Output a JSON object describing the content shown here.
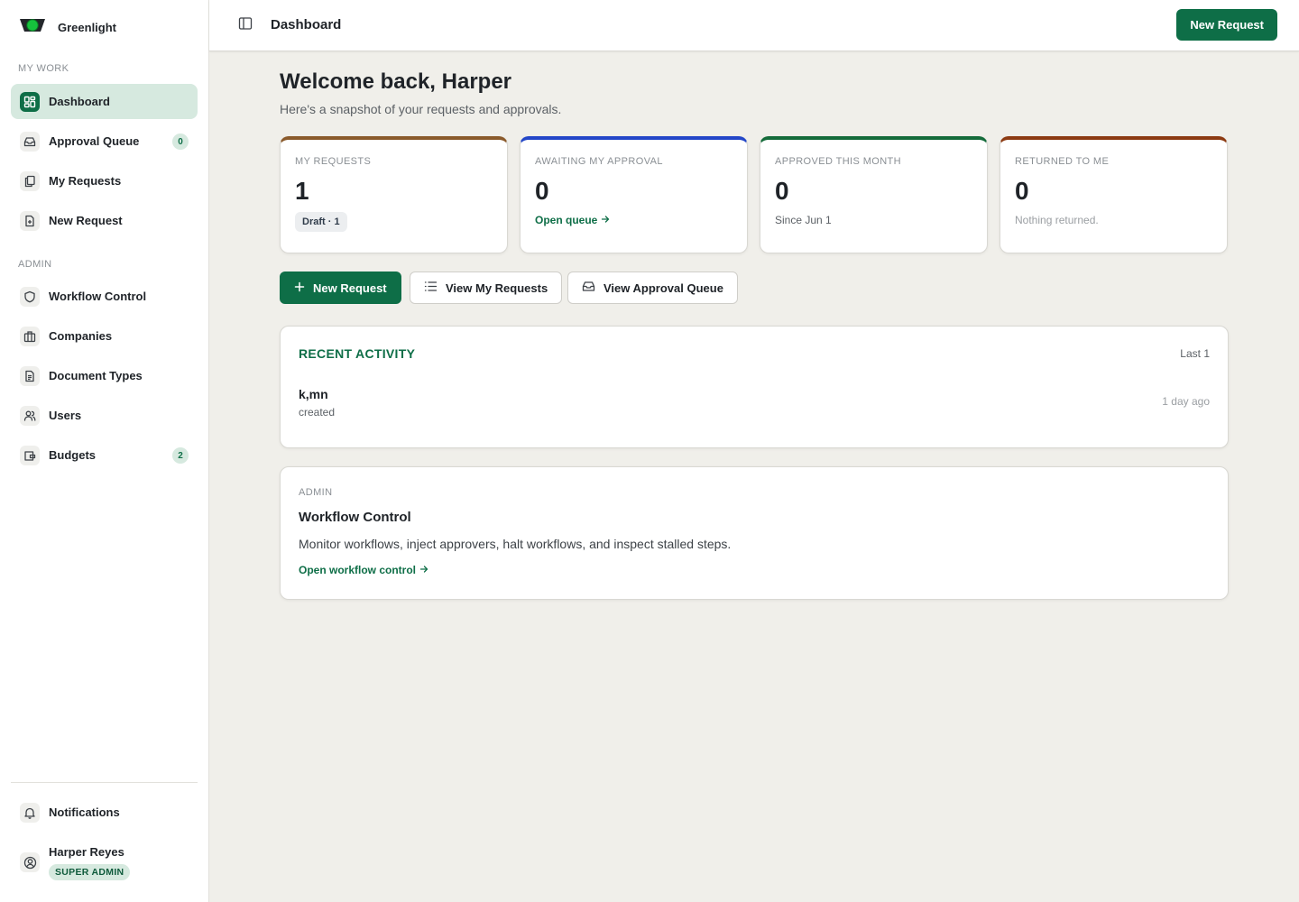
{
  "app": {
    "name": "Greenlight"
  },
  "sidebar": {
    "my_work_label": "MY WORK",
    "admin_label": "ADMIN",
    "items": [
      {
        "label": "Dashboard",
        "icon": "dashboard-icon"
      },
      {
        "label": "Approval Queue",
        "icon": "inbox-icon",
        "badge": "0"
      },
      {
        "label": "My Requests",
        "icon": "documents-icon"
      },
      {
        "label": "New Request",
        "icon": "file-plus-icon"
      },
      {
        "label": "Workflow Control",
        "icon": "shield-icon"
      },
      {
        "label": "Companies",
        "icon": "building-icon"
      },
      {
        "label": "Document Types",
        "icon": "file-text-icon"
      },
      {
        "label": "Users",
        "icon": "users-icon"
      },
      {
        "label": "Budgets",
        "icon": "wallet-icon",
        "badge": "2"
      }
    ],
    "notifications_label": "Notifications",
    "user": {
      "name": "Harper Reyes",
      "role": "SUPER ADMIN"
    }
  },
  "header": {
    "title": "Dashboard",
    "new_request_label": "New Request"
  },
  "main": {
    "welcome": "Welcome back, Harper",
    "subtitle": "Here's a snapshot of your requests and approvals.",
    "stats": [
      {
        "label": "MY REQUESTS",
        "value": "1",
        "chip": "Draft · 1",
        "accent": "#8a5a2b"
      },
      {
        "label": "AWAITING MY APPROVAL",
        "value": "0",
        "link": "Open queue",
        "accent": "#2346c8"
      },
      {
        "label": "APPROVED THIS MONTH",
        "value": "0",
        "foot": "Since Jun 1",
        "accent": "#146b3a"
      },
      {
        "label": "RETURNED TO ME",
        "value": "0",
        "muted": "Nothing returned.",
        "accent": "#8c3a12"
      }
    ],
    "actions": {
      "new_request": "New Request",
      "view_my_requests": "View My Requests",
      "view_approval_queue": "View Approval Queue"
    },
    "recent_activity": {
      "heading": "RECENT ACTIVITY",
      "meta": "Last 1",
      "items": [
        {
          "title": "k,mn",
          "action": "created",
          "time": "1 day ago"
        }
      ]
    },
    "admin_card": {
      "eyebrow": "ADMIN",
      "title": "Workflow Control",
      "description": "Monitor workflows, inject approvers, halt workflows, and inspect stalled steps.",
      "link": "Open workflow control"
    }
  },
  "colors": {
    "brand": "#0e6e47",
    "brand_light": "#d6e9df",
    "page_bg": "#f0efea"
  }
}
